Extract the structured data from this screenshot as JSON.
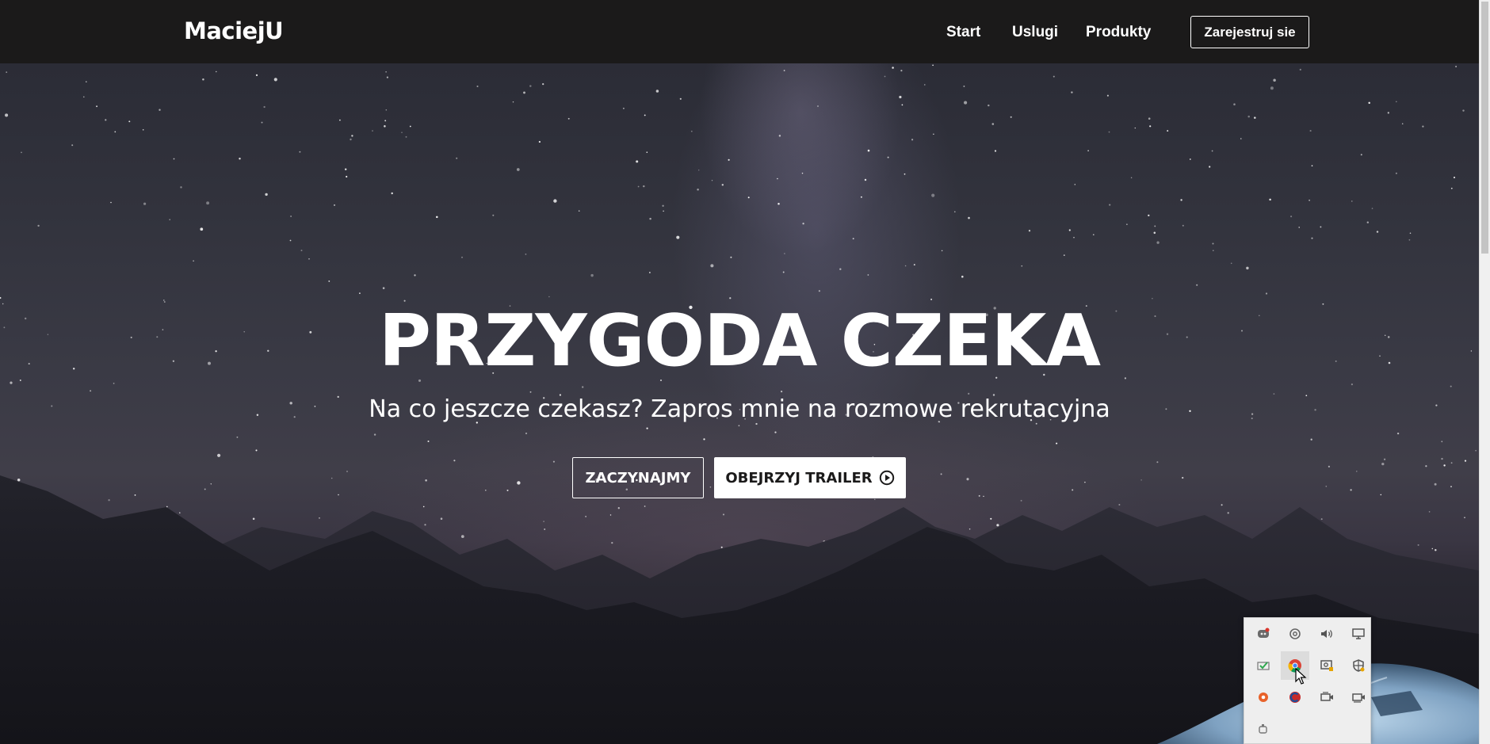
{
  "navbar": {
    "logo": "MaciejU",
    "links": [
      "Start",
      "Uslugi",
      "Produkty"
    ],
    "signup_label": "Zarejestruj sie"
  },
  "hero": {
    "title": "PRZYGODA CZEKA",
    "subtitle": "Na co jeszcze czekasz? Zapros mnie na rozmowe rekrutacyjna",
    "start_button": "ZACZYNAJMY",
    "trailer_button": "OBEJRZYJ TRAILER",
    "trailer_icon": "play-circle-icon"
  },
  "tray": {
    "icons": [
      "discord-icon",
      "settings-gear-icon",
      "speaker-icon",
      "monitor-network-icon",
      "check-shield-icon",
      "chrome-icon",
      "screen-lock-icon",
      "security-shield-icon",
      "orange-circle-icon",
      "ccleaner-icon",
      "camera-icon",
      "camera-alt-icon",
      "usb-icon"
    ],
    "active_icon": "chrome-icon"
  },
  "colors": {
    "navbar_bg": "#1b1a1a",
    "text": "#ffffff",
    "trailer_button_bg": "#ffffff",
    "trailer_button_text": "#1b1a1a"
  }
}
